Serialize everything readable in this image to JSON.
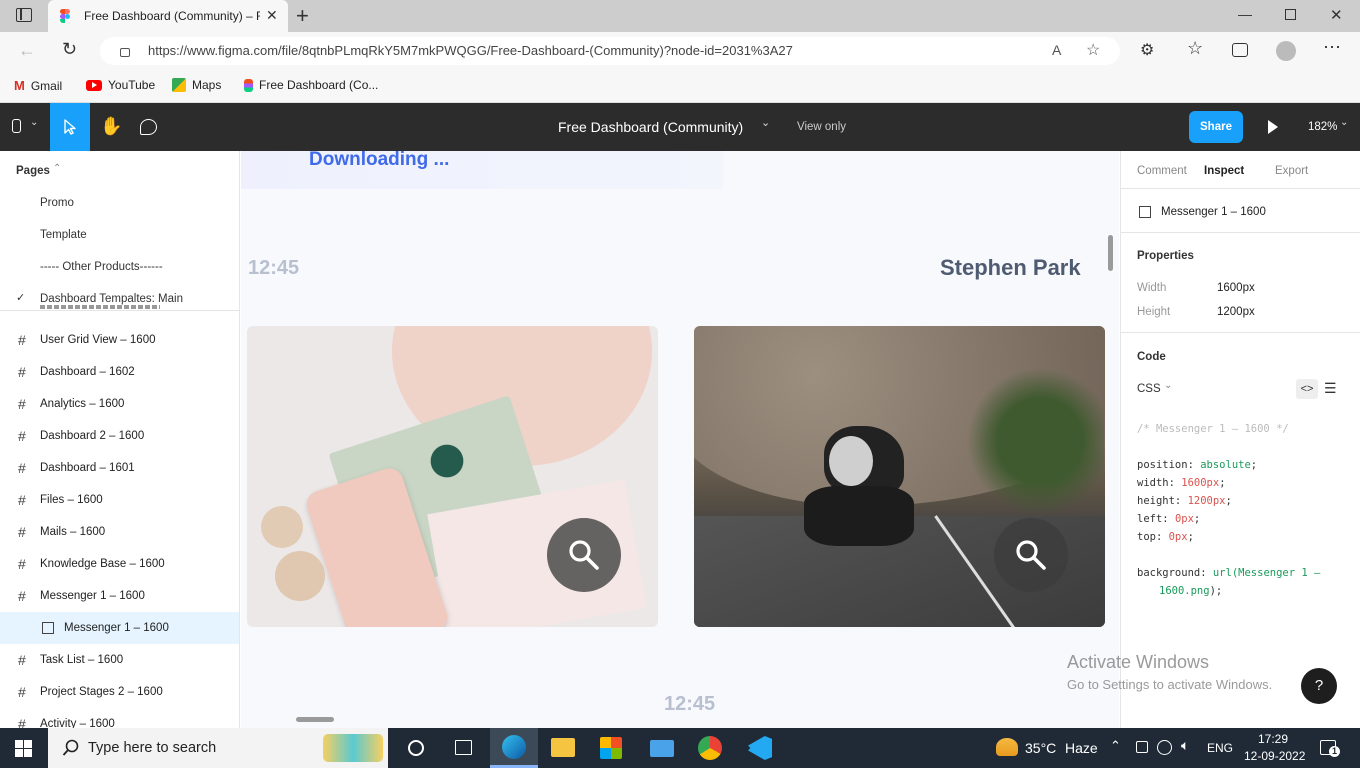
{
  "browser": {
    "tab_title": "Free Dashboard (Community) – F",
    "url": "https://www.figma.com/file/8qtnbPLmqRkY5M7mkPWQGG/Free-Dashboard-(Community)?node-id=2031%3A27",
    "bookmarks": [
      "Gmail",
      "YouTube",
      "Maps",
      "Free Dashboard (Co..."
    ]
  },
  "figma_bar": {
    "file_title": "Free Dashboard (Community)",
    "view_mode": "View only",
    "share_label": "Share",
    "zoom": "182%"
  },
  "left_panel": {
    "pages_label": "Pages",
    "pages": [
      "Promo",
      "Template",
      "----- Other Products------",
      "Dashboard Tempaltes: Main"
    ],
    "layers": [
      "User Grid View – 1600",
      "Dashboard – 1602",
      "Analytics – 1600",
      "Dashboard 2 – 1600",
      "Dashboard – 1601",
      "Files – 1600",
      "Mails – 1600",
      "Knowledge Base – 1600",
      "Messenger 1 – 1600",
      "Messenger 1 – 1600",
      "Task List – 1600",
      "Project Stages 2 – 1600",
      "Activity – 1600"
    ]
  },
  "canvas": {
    "downloading": "Downloading ...",
    "time_left": "12:45",
    "name": "Stephen Park",
    "time_bottom": "12:45",
    "watermark_title": "Activate Windows",
    "watermark_sub": "Go to Settings to activate Windows."
  },
  "right_panel": {
    "tabs": [
      "Comment",
      "Inspect",
      "Export"
    ],
    "selected_frame": "Messenger 1 – 1600",
    "properties_label": "Properties",
    "width_label": "Width",
    "width_value": "1600px",
    "height_label": "Height",
    "height_value": "1200px",
    "code_label": "Code",
    "lang": "CSS",
    "code_comment": "/* Messenger 1 – 1600 */",
    "code_lines": {
      "position_key": "position: ",
      "position_val": "absolute",
      "width_key": "width: ",
      "width_val": "1600px",
      "height_key": "height: ",
      "height_val": "1200px",
      "left_key": "left: ",
      "left_val": "0px",
      "top_key": "top: ",
      "top_val": "0px",
      "bg_key": "background: ",
      "bg_fn": "url(",
      "bg_val1": "Messenger 1 –",
      "bg_val2": "1600.png",
      "bg_end": ");"
    },
    "help": "?"
  },
  "taskbar": {
    "search_placeholder": "Type here to search",
    "weather_temp": "35°C",
    "weather_desc": "Haze",
    "lang": "ENG",
    "time": "17:29",
    "date": "12-09-2022",
    "notif_count": "1"
  },
  "colors": {
    "figma_dark": "#2c2c2c",
    "figma_blue": "#18a0fb",
    "canvas_bg": "#f8f9fc",
    "taskbar": "#1f2a36"
  }
}
